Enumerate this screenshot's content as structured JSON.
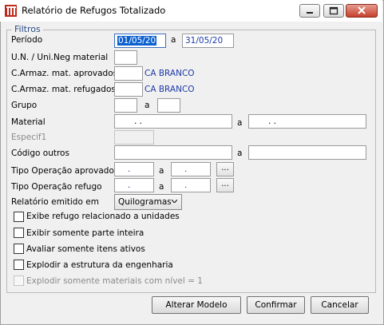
{
  "window": {
    "title": "Relatório de Refugos Totalizado"
  },
  "filters": {
    "legend": "Filtros",
    "periodo": {
      "label": "Período",
      "from": "01/05/20",
      "sep": "a",
      "to": "31/05/20"
    },
    "un": {
      "label": "U.N. / Uni.Neg material",
      "value": ""
    },
    "armaz_aprov": {
      "label": "C.Armaz. mat. aprovados",
      "value": "",
      "desc": "CA BRANCO"
    },
    "armaz_refug": {
      "label": "C.Armaz. mat. refugados",
      "value": "",
      "desc": "CA BRANCO"
    },
    "grupo": {
      "label": "Grupo",
      "from": "",
      "sep": "a",
      "to": ""
    },
    "material": {
      "label": "Material",
      "from": ".   .",
      "sep": "a",
      "to": ".   ."
    },
    "especif1": {
      "label": "Especif1",
      "value": ""
    },
    "codigo_outros": {
      "label": "Código outros",
      "from": "",
      "sep": "a",
      "to": ""
    },
    "tipo_op_aprov": {
      "label": "Tipo Operação aprovado",
      "from": ".",
      "sep": "a",
      "to": ".",
      "lookup": "..."
    },
    "tipo_op_refugo": {
      "label": "Tipo Operação refugo",
      "from": ".",
      "sep": "a",
      "to": ".",
      "lookup": "..."
    },
    "relatorio_em": {
      "label": "Relatório emitido em",
      "selected": "Quilogramas"
    }
  },
  "options": [
    {
      "label": "Exibe refugo relacionado a unidades",
      "checked": false,
      "enabled": true
    },
    {
      "label": "Exibir somente parte inteira",
      "checked": false,
      "enabled": true
    },
    {
      "label": "Avaliar somente itens ativos",
      "checked": false,
      "enabled": true
    },
    {
      "label": "Explodir a estrutura da engenharia",
      "checked": false,
      "enabled": true
    },
    {
      "label": "Explodir somente materiais com nível = 1",
      "checked": false,
      "enabled": false
    }
  ],
  "buttons": {
    "alterar": "Alterar Modelo",
    "confirmar": "Confirmar",
    "cancelar": "Cancelar"
  },
  "icons": {
    "app": "report-icon",
    "minimize": "minimize-icon",
    "maximize": "maximize-icon",
    "close": "close-icon"
  },
  "colors": {
    "accent": "#0a60d0",
    "legend": "#2a4d86",
    "desc": "#1d3aa8",
    "close": "#c6402c"
  }
}
